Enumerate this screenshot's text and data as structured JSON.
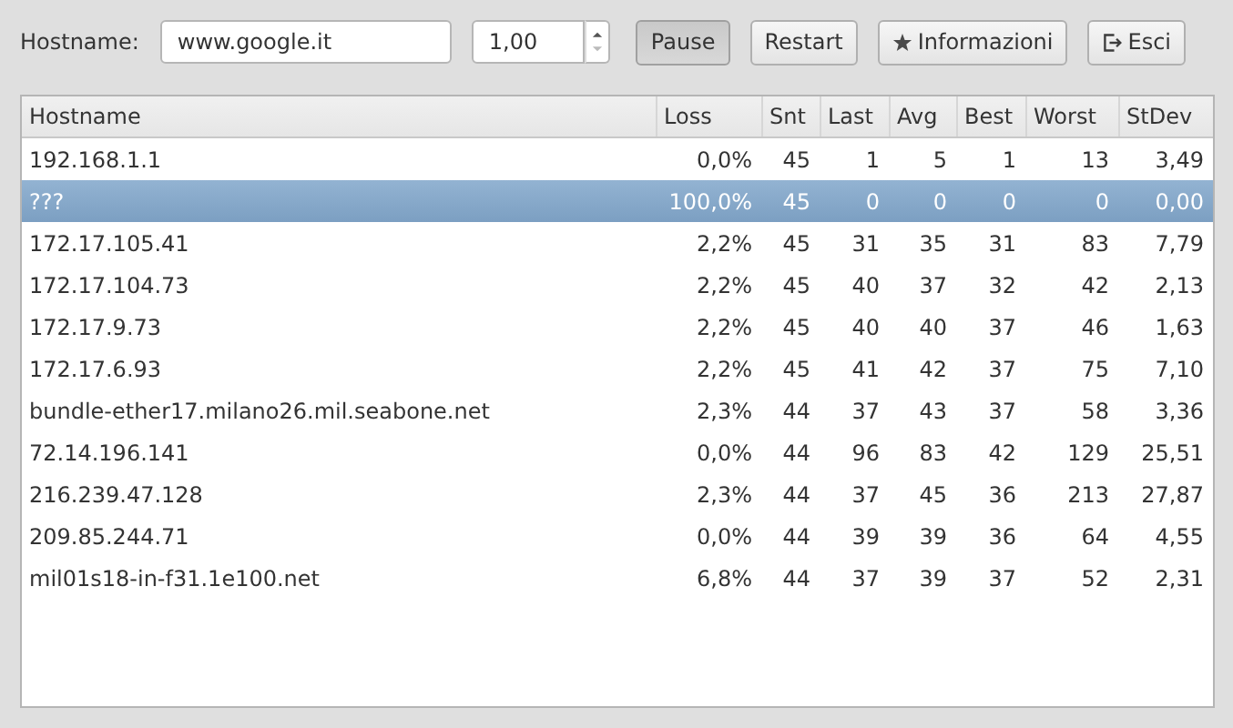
{
  "toolbar": {
    "hostname_label": "Hostname:",
    "hostname_value": "www.google.it",
    "interval_value": "1,00",
    "buttons": [
      {
        "label": "Pause",
        "kind": "plain",
        "pressed": true
      },
      {
        "label": "Restart",
        "kind": "plain",
        "pressed": false
      },
      {
        "label": "Informazioni",
        "kind": "star",
        "pressed": false
      },
      {
        "label": "Esci",
        "kind": "exit",
        "pressed": false
      }
    ]
  },
  "table": {
    "columns": [
      "Hostname",
      "Loss",
      "Snt",
      "Last",
      "Avg",
      "Best",
      "Worst",
      "StDev"
    ],
    "rows": [
      {
        "selected": false,
        "cells": [
          "192.168.1.1",
          "0,0%",
          "45",
          "1",
          "5",
          "1",
          "13",
          "3,49"
        ]
      },
      {
        "selected": true,
        "cells": [
          "???",
          "100,0%",
          "45",
          "0",
          "0",
          "0",
          "0",
          "0,00"
        ]
      },
      {
        "selected": false,
        "cells": [
          "172.17.105.41",
          "2,2%",
          "45",
          "31",
          "35",
          "31",
          "83",
          "7,79"
        ]
      },
      {
        "selected": false,
        "cells": [
          "172.17.104.73",
          "2,2%",
          "45",
          "40",
          "37",
          "32",
          "42",
          "2,13"
        ]
      },
      {
        "selected": false,
        "cells": [
          "172.17.9.73",
          "2,2%",
          "45",
          "40",
          "40",
          "37",
          "46",
          "1,63"
        ]
      },
      {
        "selected": false,
        "cells": [
          "172.17.6.93",
          "2,2%",
          "45",
          "41",
          "42",
          "37",
          "75",
          "7,10"
        ]
      },
      {
        "selected": false,
        "cells": [
          "bundle-ether17.milano26.mil.seabone.net",
          "2,3%",
          "44",
          "37",
          "43",
          "37",
          "58",
          "3,36"
        ]
      },
      {
        "selected": false,
        "cells": [
          "72.14.196.141",
          "0,0%",
          "44",
          "96",
          "83",
          "42",
          "129",
          "25,51"
        ]
      },
      {
        "selected": false,
        "cells": [
          "216.239.47.128",
          "2,3%",
          "44",
          "37",
          "45",
          "36",
          "213",
          "27,87"
        ]
      },
      {
        "selected": false,
        "cells": [
          "209.85.244.71",
          "0,0%",
          "44",
          "39",
          "39",
          "36",
          "64",
          "4,55"
        ]
      },
      {
        "selected": false,
        "cells": [
          "mil01s18-in-f31.1e100.net",
          "6,8%",
          "44",
          "37",
          "39",
          "37",
          "52",
          "2,31"
        ]
      }
    ]
  }
}
